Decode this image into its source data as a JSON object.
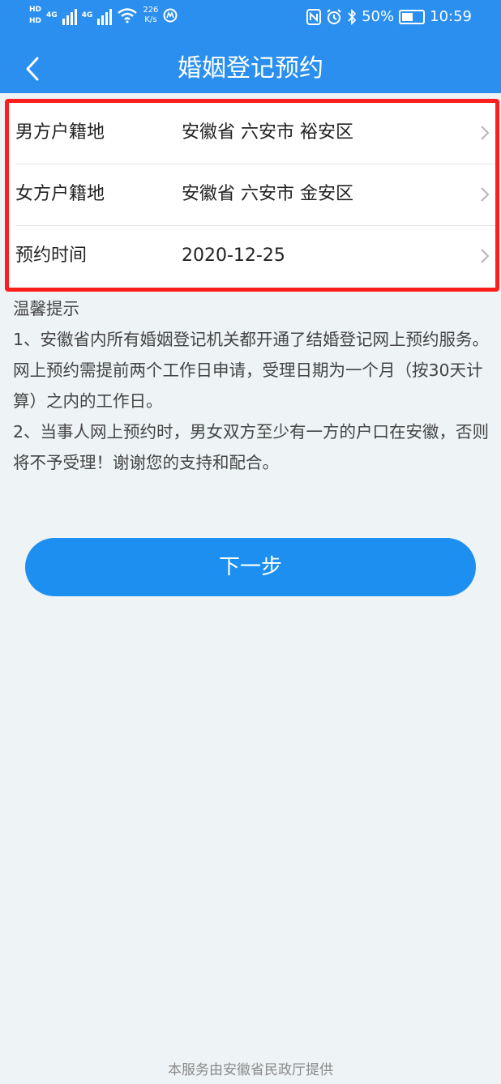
{
  "status_bar": {
    "hd1": "HD",
    "hd2": "HD",
    "net1": "4G",
    "net2": "4G",
    "speed_value": "226",
    "speed_unit": "K/s",
    "battery": "50%",
    "time": "10:59",
    "icons": [
      "nfc-icon",
      "alarm-icon",
      "bluetooth-icon",
      "battery-icon",
      "wifi-icon",
      "signal-icon"
    ]
  },
  "header": {
    "title": "婚姻登记预约",
    "background": "#2b8ff0"
  },
  "form": {
    "rows": [
      {
        "label": "男方户籍地",
        "value": "安徽省 六安市 裕安区"
      },
      {
        "label": "女方户籍地",
        "value": "安徽省 六安市 金安区"
      },
      {
        "label": "预约时间",
        "value": "2020-12-25"
      }
    ],
    "highlight_color": "#ff1e1e"
  },
  "tips": {
    "title": "温馨提示",
    "items": [
      "1、安徽省内所有婚姻登记机关都开通了结婚登记网上预约服务。网上预约需提前两个工作日申请，受理日期为一个月（按30天计算）之内的工作日。",
      "2、当事人网上预约时，男女双方至少有一方的户口在安徽，否则将不予受理！谢谢您的支持和配合。"
    ]
  },
  "next_button": {
    "label": "下一步",
    "color": "#1d8ff0"
  },
  "footer": {
    "text": "本服务由安徽省民政厅提供"
  }
}
